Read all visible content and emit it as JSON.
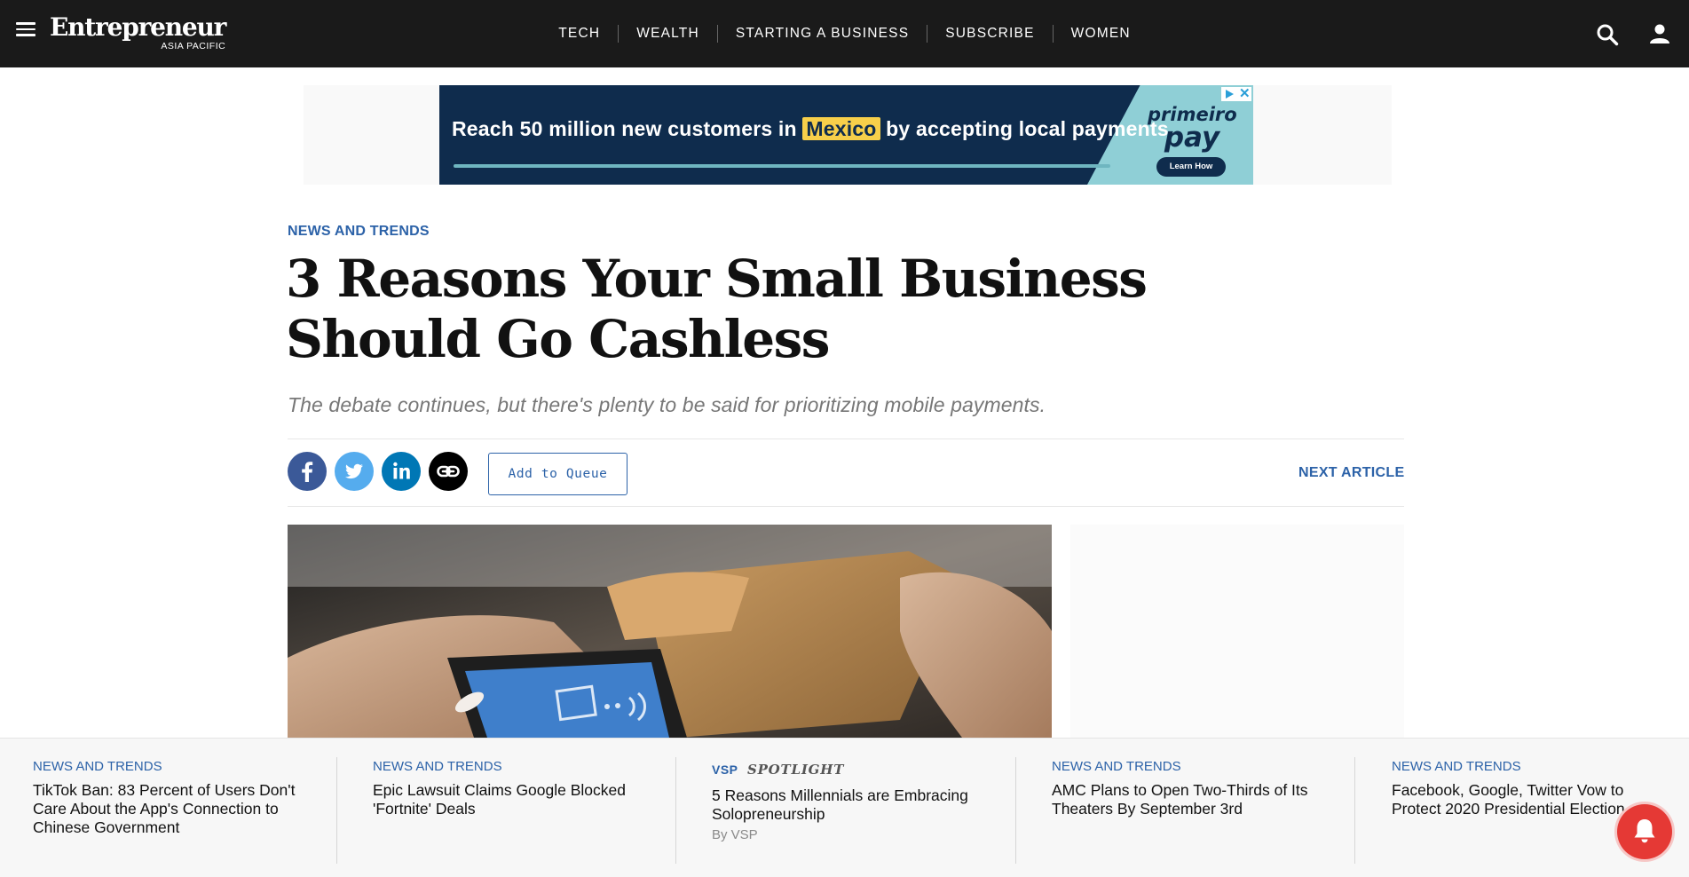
{
  "header": {
    "logo_main": "Entrepreneur",
    "logo_sub": "ASIA PACIFIC",
    "nav": [
      "TECH",
      "WEALTH",
      "STARTING A BUSINESS",
      "SUBSCRIBE",
      "WOMEN"
    ],
    "icons": {
      "menu": "hamburger-icon",
      "search": "search-icon",
      "account": "user-icon"
    }
  },
  "ad": {
    "text_before": "Reach 50 million new customers in",
    "highlight": "Mexico",
    "text_after": "by accepting local payments.",
    "brand_line1": "primeiro",
    "brand_line2": "pay",
    "cta": "Learn How"
  },
  "article": {
    "category": "NEWS AND TRENDS",
    "title": "3 Reasons Your Small Business Should Go Cashless",
    "subtitle": "The debate continues, but there's plenty to be said for prioritizing mobile payments.",
    "share": [
      {
        "icon": "facebook-icon",
        "color": "#3b5998"
      },
      {
        "icon": "twitter-icon",
        "color": "#55acee"
      },
      {
        "icon": "linkedin-icon",
        "color": "#0077b5"
      },
      {
        "icon": "link-icon",
        "color": "#000000"
      }
    ],
    "queue_button": "Add to Queue",
    "next_article": "NEXT ARTICLE"
  },
  "bottom": {
    "cards": [
      {
        "category": "NEWS AND TRENDS",
        "title": "TikTok Ban: 83 Percent of Users Don't Care About the App's Connection to Chinese Government"
      },
      {
        "category": "NEWS AND TRENDS",
        "title": "Epic Lawsuit Claims Google Blocked 'Fortnite' Deals"
      },
      {
        "brand": "VSP",
        "label": "SPOTLIGHT",
        "title": "5 Reasons Millennials are Embracing Solopreneurship",
        "byline": "By VSP"
      },
      {
        "category": "NEWS AND TRENDS",
        "title": "AMC Plans to Open Two-Thirds of Its Theaters By September 3rd"
      },
      {
        "category": "NEWS AND TRENDS",
        "title": "Facebook, Google, Twitter Vow to Protect 2020 Presidential Election"
      }
    ]
  },
  "colors": {
    "accent": "#2c62a8",
    "nav_bg": "#1a1a1a",
    "notification": "#e53935"
  }
}
